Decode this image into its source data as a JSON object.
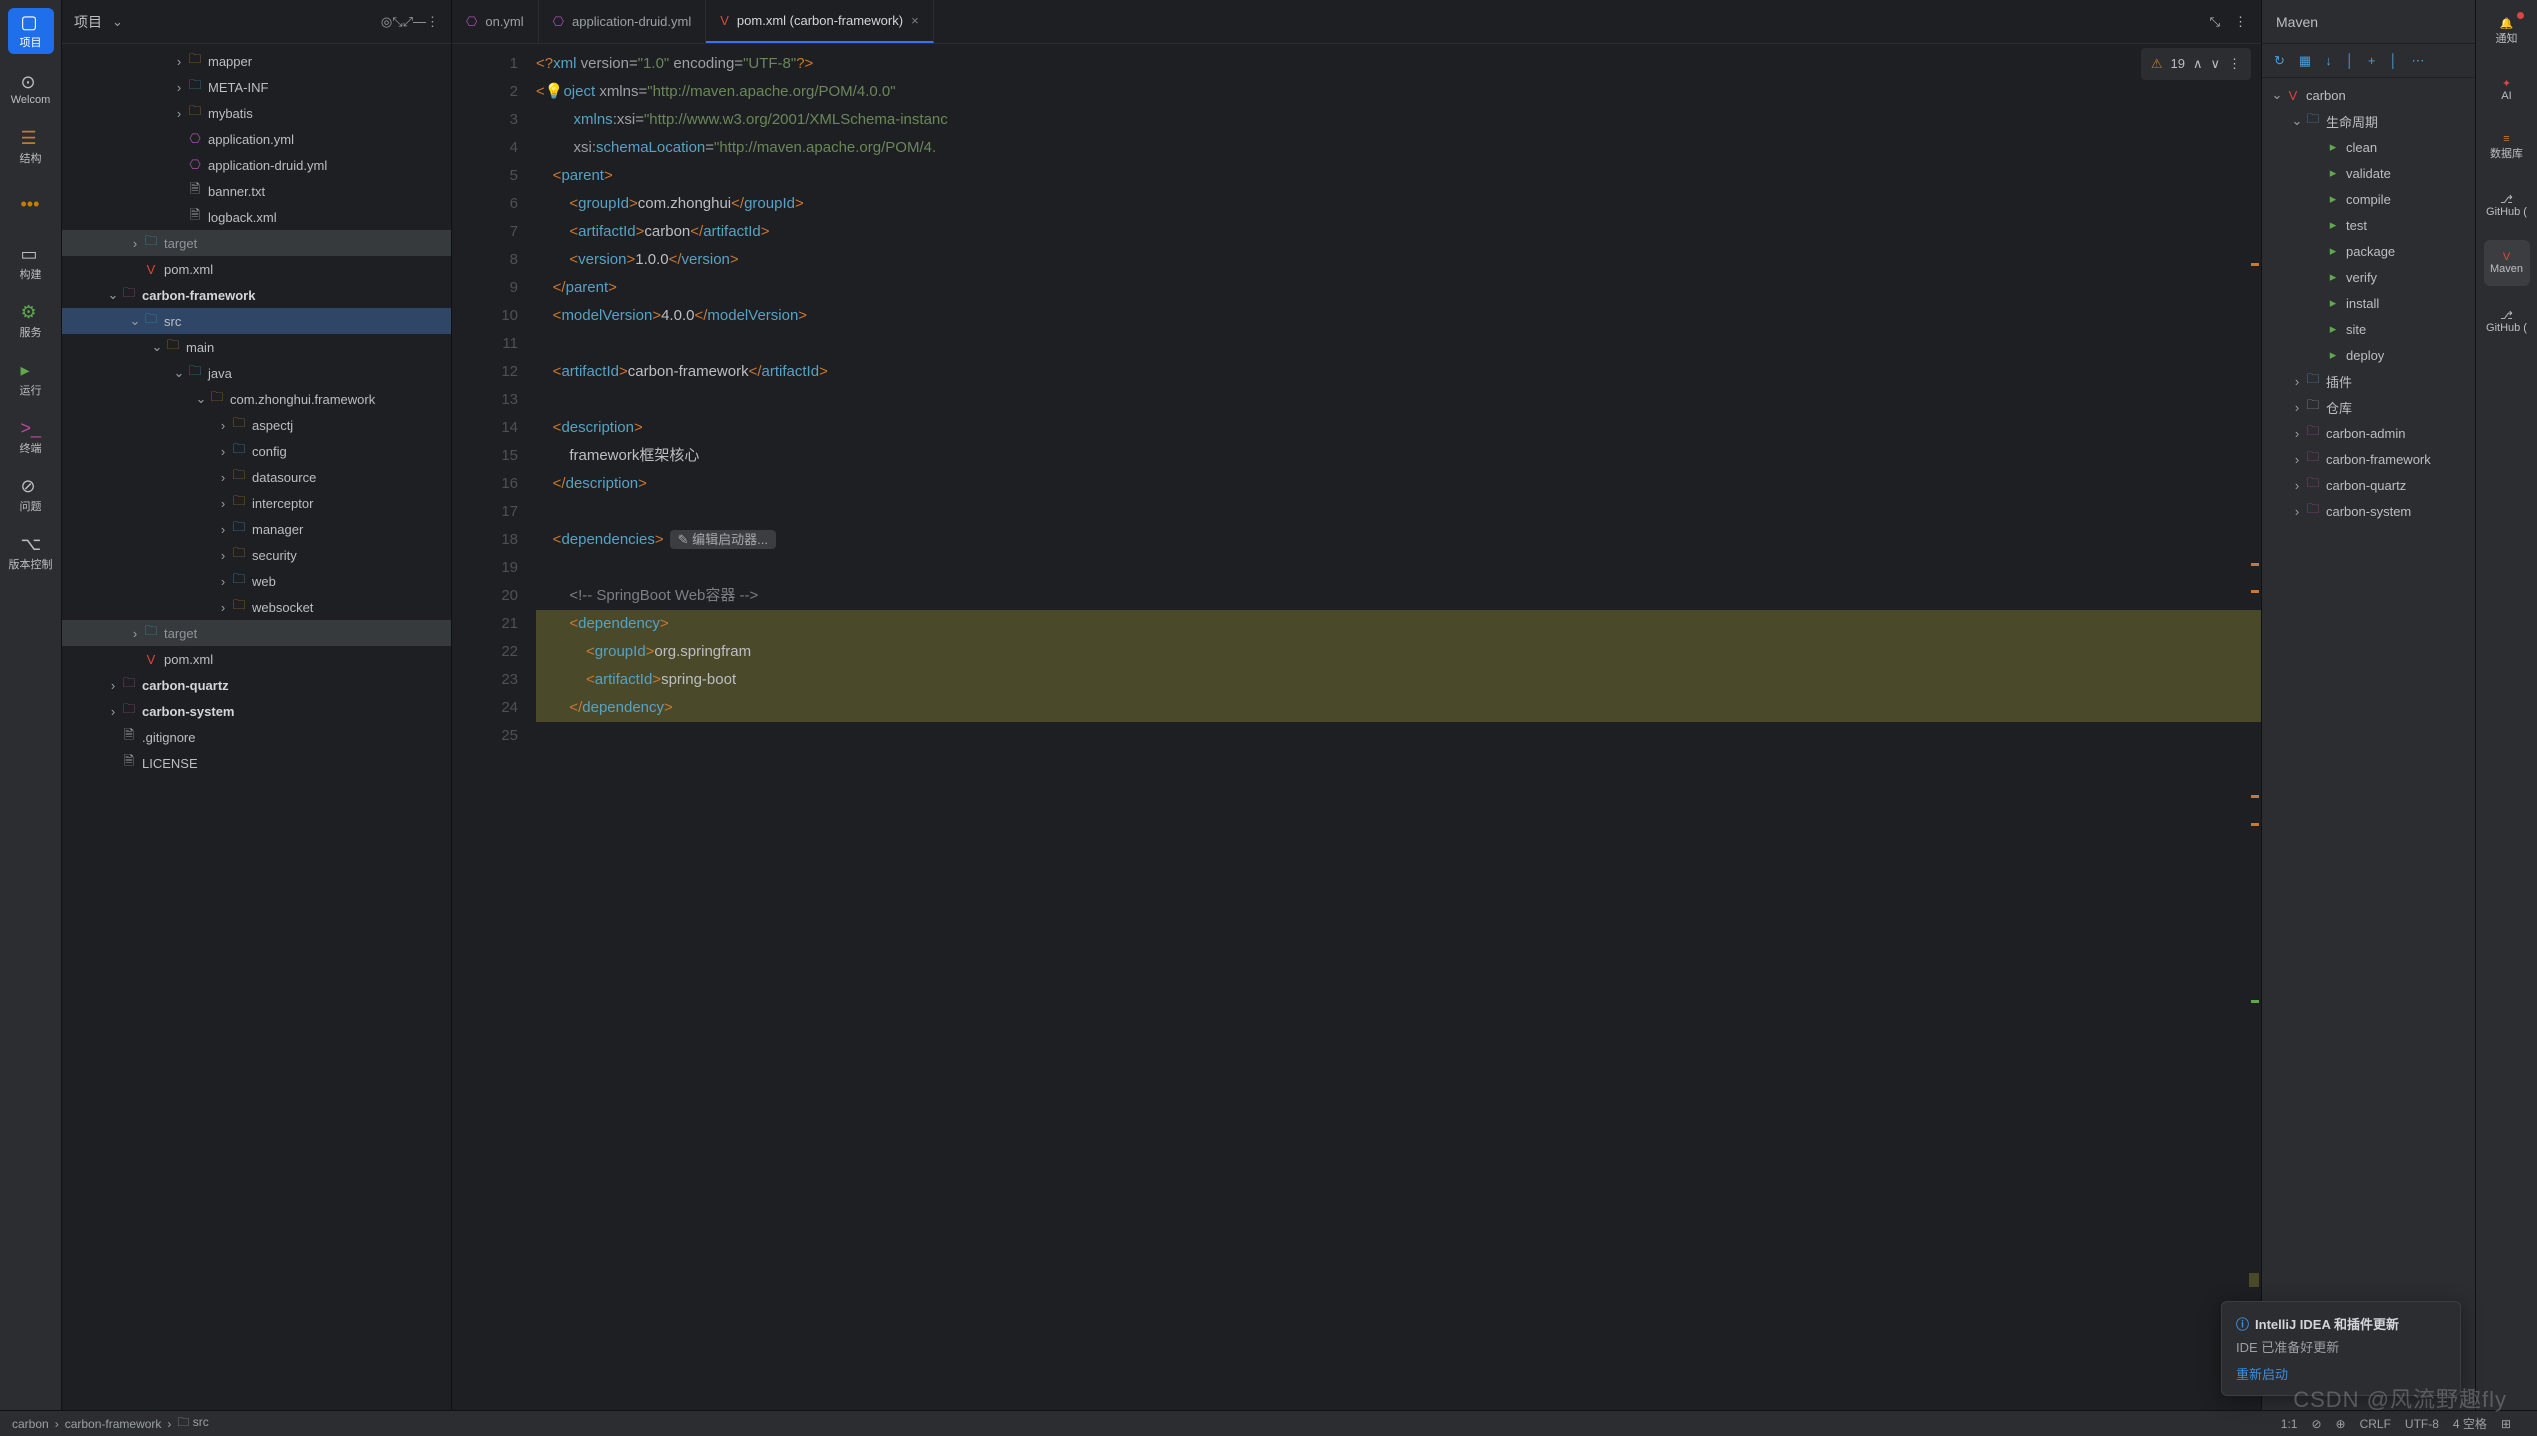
{
  "leftStrip": [
    {
      "icon": "▢",
      "label": "项目",
      "sel": true
    },
    {
      "icon": "⊙",
      "label": "Welcom"
    },
    {
      "icon": "☰",
      "label": "结构",
      "color": "#c07c2e"
    },
    {
      "icon": "•••",
      "label": "",
      "color": "#c77d00"
    },
    {
      "icon": "▭",
      "label": "构建"
    },
    {
      "icon": "⚙",
      "label": "服务",
      "color": "#5fa84c"
    },
    {
      "icon": "▸",
      "label": "运行",
      "color": "#5fa84c"
    },
    {
      "icon": ">_",
      "label": "终端",
      "color": "#b84a9e"
    },
    {
      "icon": "⊘",
      "label": "问题"
    },
    {
      "icon": "⌥",
      "label": "版本控制"
    }
  ],
  "project": {
    "title": "项目",
    "headIcons": [
      "◎",
      "⤡",
      "⤢",
      "—",
      "⋮"
    ],
    "tree": [
      {
        "d": 5,
        "chev": "›",
        "ic": "fold",
        "t": "mapper"
      },
      {
        "d": 5,
        "chev": "›",
        "ic": "folda",
        "t": "META-INF"
      },
      {
        "d": 5,
        "chev": "›",
        "ic": "fold",
        "t": "mybatis"
      },
      {
        "d": 5,
        "chev": "",
        "ic": "yml",
        "t": "application.yml"
      },
      {
        "d": 5,
        "chev": "",
        "ic": "yml",
        "t": "application-druid.yml"
      },
      {
        "d": 5,
        "chev": "",
        "ic": "file",
        "t": "banner.txt"
      },
      {
        "d": 5,
        "chev": "",
        "ic": "file",
        "t": "logback.xml"
      },
      {
        "d": 3,
        "chev": "›",
        "ic": "folda",
        "t": "target",
        "dim": true
      },
      {
        "d": 3,
        "chev": "",
        "ic": "mvn",
        "t": "pom.xml"
      },
      {
        "d": 2,
        "chev": "⌄",
        "ic": "mdl",
        "t": "carbon-framework",
        "bold": true
      },
      {
        "d": 3,
        "chev": "⌄",
        "ic": "folda",
        "t": "src",
        "sel": true
      },
      {
        "d": 4,
        "chev": "⌄",
        "ic": "fold",
        "t": "main"
      },
      {
        "d": 5,
        "chev": "⌄",
        "ic": "pkg",
        "t": "java"
      },
      {
        "d": 6,
        "chev": "⌄",
        "ic": "fold",
        "t": "com.zhonghui.framework"
      },
      {
        "d": 7,
        "chev": "›",
        "ic": "fold",
        "t": "aspectj"
      },
      {
        "d": 7,
        "chev": "›",
        "ic": "cfg",
        "t": "config"
      },
      {
        "d": 7,
        "chev": "›",
        "ic": "fold",
        "t": "datasource"
      },
      {
        "d": 7,
        "chev": "›",
        "ic": "fold",
        "t": "interceptor"
      },
      {
        "d": 7,
        "chev": "›",
        "ic": "cfg",
        "t": "manager"
      },
      {
        "d": 7,
        "chev": "›",
        "ic": "fold",
        "t": "security"
      },
      {
        "d": 7,
        "chev": "›",
        "ic": "cfg",
        "t": "web"
      },
      {
        "d": 7,
        "chev": "›",
        "ic": "fold",
        "t": "websocket"
      },
      {
        "d": 3,
        "chev": "›",
        "ic": "folda",
        "t": "target",
        "dim": true
      },
      {
        "d": 3,
        "chev": "",
        "ic": "mvn",
        "t": "pom.xml"
      },
      {
        "d": 2,
        "chev": "›",
        "ic": "mdl",
        "t": "carbon-quartz",
        "bold": true
      },
      {
        "d": 2,
        "chev": "›",
        "ic": "mdl",
        "t": "carbon-system",
        "bold": true
      },
      {
        "d": 2,
        "chev": "",
        "ic": "file",
        "t": ".gitignore"
      },
      {
        "d": 2,
        "chev": "",
        "ic": "file",
        "t": "LICENSE"
      }
    ]
  },
  "tabs": [
    {
      "icon": "yml",
      "label": "on.yml",
      "trunc": true
    },
    {
      "icon": "yml",
      "label": "application-druid.yml"
    },
    {
      "icon": "mvn",
      "label": "pom.xml (carbon-framework)",
      "active": true,
      "close": true
    }
  ],
  "tabActions": [
    "⤡",
    "⋮"
  ],
  "inspection": {
    "warnIcon": "⚠",
    "count": "19",
    "up": "∧",
    "down": "∨"
  },
  "code": {
    "lines": [
      {
        "n": 1,
        "seg": [
          [
            "dec",
            "<?"
          ],
          [
            "tag",
            "xml "
          ],
          [
            "attr",
            "version="
          ],
          [
            "str",
            "\"1.0\" "
          ],
          [
            "attr",
            "encoding="
          ],
          [
            "str",
            "\"UTF-8\""
          ],
          [
            "dec",
            "?>"
          ]
        ]
      },
      {
        "n": 2,
        "bulb": true,
        "seg": [
          [
            "dec",
            "<"
          ],
          [
            "bulb",
            "💡"
          ],
          [
            "tag",
            "oject "
          ],
          [
            "attr",
            "xmlns="
          ],
          [
            "str",
            "\"http://maven.apache.org/POM/4.0.0\""
          ]
        ]
      },
      {
        "n": 3,
        "seg": [
          [
            "txt",
            "         "
          ],
          [
            "tag",
            "xmlns"
          ],
          [
            "attr",
            ":xsi="
          ],
          [
            "str",
            "\"http://www.w3.org/2001/XMLSchema-instanc"
          ]
        ]
      },
      {
        "n": 4,
        "seg": [
          [
            "txt",
            "         "
          ],
          [
            "attr",
            "xsi:"
          ],
          [
            "tag",
            "schemaLocation"
          ],
          [
            "attr",
            "="
          ],
          [
            "str",
            "\"http://maven.apache.org/POM/4."
          ]
        ]
      },
      {
        "n": 5,
        "gic": "✓",
        "seg": [
          [
            "txt",
            "    "
          ],
          [
            "dec",
            "<"
          ],
          [
            "tag",
            "parent"
          ],
          [
            "dec",
            ">"
          ]
        ]
      },
      {
        "n": 6,
        "seg": [
          [
            "txt",
            "        "
          ],
          [
            "dec",
            "<"
          ],
          [
            "tag",
            "groupId"
          ],
          [
            "dec",
            ">"
          ],
          [
            "txt",
            "com.zhonghui"
          ],
          [
            "dec",
            "</"
          ],
          [
            "tag",
            "groupId"
          ],
          [
            "dec",
            ">"
          ]
        ]
      },
      {
        "n": 7,
        "seg": [
          [
            "txt",
            "        "
          ],
          [
            "dec",
            "<"
          ],
          [
            "tag",
            "artifactId"
          ],
          [
            "dec",
            ">"
          ],
          [
            "txt",
            "carbon"
          ],
          [
            "dec",
            "</"
          ],
          [
            "tag",
            "artifactId"
          ],
          [
            "dec",
            ">"
          ]
        ]
      },
      {
        "n": 8,
        "seg": [
          [
            "txt",
            "        "
          ],
          [
            "dec",
            "<"
          ],
          [
            "tag",
            "version"
          ],
          [
            "dec",
            ">"
          ],
          [
            "txt",
            "1.0.0"
          ],
          [
            "dec",
            "</"
          ],
          [
            "tag",
            "version"
          ],
          [
            "dec",
            ">"
          ]
        ]
      },
      {
        "n": 9,
        "seg": [
          [
            "txt",
            "    "
          ],
          [
            "dec",
            "</"
          ],
          [
            "tag",
            "parent"
          ],
          [
            "dec",
            ">"
          ]
        ]
      },
      {
        "n": 10,
        "seg": [
          [
            "txt",
            "    "
          ],
          [
            "dec",
            "<"
          ],
          [
            "tag",
            "modelVersion"
          ],
          [
            "dec",
            ">"
          ],
          [
            "txt",
            "4.0.0"
          ],
          [
            "dec",
            "</"
          ],
          [
            "tag",
            "modelVersion"
          ],
          [
            "dec",
            ">"
          ]
        ]
      },
      {
        "n": 11,
        "seg": []
      },
      {
        "n": 12,
        "seg": [
          [
            "txt",
            "    "
          ],
          [
            "dec",
            "<"
          ],
          [
            "tag",
            "artifactId"
          ],
          [
            "dec",
            ">"
          ],
          [
            "txt",
            "carbon-framework"
          ],
          [
            "dec",
            "</"
          ],
          [
            "tag",
            "artifactId"
          ],
          [
            "dec",
            ">"
          ]
        ]
      },
      {
        "n": 13,
        "seg": []
      },
      {
        "n": 14,
        "seg": [
          [
            "txt",
            "    "
          ],
          [
            "dec",
            "<"
          ],
          [
            "tag",
            "description"
          ],
          [
            "dec",
            ">"
          ]
        ]
      },
      {
        "n": 15,
        "seg": [
          [
            "txt",
            "        framework框架核心"
          ]
        ]
      },
      {
        "n": 16,
        "seg": [
          [
            "txt",
            "    "
          ],
          [
            "dec",
            "</"
          ],
          [
            "tag",
            "description"
          ],
          [
            "dec",
            ">"
          ]
        ]
      },
      {
        "n": 17,
        "seg": []
      },
      {
        "n": 18,
        "inlay": "编辑启动器...",
        "inlayIcon": "✎",
        "seg": [
          [
            "txt",
            "    "
          ],
          [
            "dec",
            "<"
          ],
          [
            "tag",
            "dependencies"
          ],
          [
            "dec",
            ">"
          ]
        ]
      },
      {
        "n": 19,
        "seg": []
      },
      {
        "n": 20,
        "seg": [
          [
            "txt",
            "        "
          ],
          [
            "cmt",
            "<!-- SpringBoot Web容器 -->"
          ]
        ]
      },
      {
        "n": 21,
        "gic": "⇥",
        "hl": true,
        "seg": [
          [
            "txt",
            "        "
          ],
          [
            "dec",
            "<"
          ],
          [
            "tag",
            "dependency"
          ],
          [
            "dec",
            ">"
          ]
        ]
      },
      {
        "n": 22,
        "hl": true,
        "seg": [
          [
            "txt",
            "            "
          ],
          [
            "dec",
            "<"
          ],
          [
            "tag",
            "groupId"
          ],
          [
            "dec",
            ">"
          ],
          [
            "txt",
            "org.springfram"
          ]
        ]
      },
      {
        "n": 23,
        "hl": true,
        "seg": [
          [
            "txt",
            "            "
          ],
          [
            "dec",
            "<"
          ],
          [
            "tag",
            "artifactId"
          ],
          [
            "dec",
            ">"
          ],
          [
            "txt",
            "spring-boot"
          ]
        ]
      },
      {
        "n": 24,
        "hl": true,
        "seg": [
          [
            "txt",
            "        "
          ],
          [
            "dec",
            "</"
          ],
          [
            "tag",
            "dependency"
          ],
          [
            "dec",
            ">"
          ]
        ]
      },
      {
        "n": 25,
        "seg": []
      }
    ]
  },
  "maven": {
    "title": "Maven",
    "toolbar": [
      "↻",
      "▦",
      "↓",
      "│",
      "+",
      "│",
      "⋯"
    ],
    "tree": [
      {
        "d": 0,
        "chev": "⌄",
        "ic": "mvn",
        "t": "carbon"
      },
      {
        "d": 1,
        "chev": "⌄",
        "ic": "fold",
        "t": "生命周期"
      },
      {
        "d": 2,
        "ic": "run",
        "t": "clean"
      },
      {
        "d": 2,
        "ic": "run",
        "t": "validate"
      },
      {
        "d": 2,
        "ic": "run",
        "t": "compile"
      },
      {
        "d": 2,
        "ic": "run",
        "t": "test"
      },
      {
        "d": 2,
        "ic": "run",
        "t": "package"
      },
      {
        "d": 2,
        "ic": "run",
        "t": "verify"
      },
      {
        "d": 2,
        "ic": "run",
        "t": "install"
      },
      {
        "d": 2,
        "ic": "run",
        "t": "site"
      },
      {
        "d": 2,
        "ic": "run",
        "t": "deploy"
      },
      {
        "d": 1,
        "chev": "›",
        "ic": "fold",
        "t": "插件"
      },
      {
        "d": 1,
        "chev": "›",
        "ic": "fold",
        "t": "仓库",
        "grey": true
      },
      {
        "d": 1,
        "chev": "›",
        "ic": "mod",
        "t": "carbon-admin"
      },
      {
        "d": 1,
        "chev": "›",
        "ic": "mod",
        "t": "carbon-framework"
      },
      {
        "d": 1,
        "chev": "›",
        "ic": "mod",
        "t": "carbon-quartz"
      },
      {
        "d": 1,
        "chev": "›",
        "ic": "mod",
        "t": "carbon-system"
      }
    ]
  },
  "rightStrip": [
    {
      "icon": "🔔",
      "label": "通知",
      "dot": true
    },
    {
      "icon": "✦",
      "label": "AI",
      "color": "#d44"
    },
    {
      "icon": "≡",
      "label": "数据库",
      "color": "#c07c2e"
    },
    {
      "icon": "⎇",
      "label": "GitHub ("
    },
    {
      "icon": "V",
      "label": "Maven",
      "color": "#e2443b",
      "sel": true
    },
    {
      "icon": "⎇",
      "label": "GitHub ("
    }
  ],
  "breadcrumb": [
    "carbon",
    "carbon-framework",
    "src"
  ],
  "status": {
    "pos": "1:1",
    "items": [
      "⊘",
      "⊕",
      "CRLF",
      "UTF-8",
      "4 空格",
      "⊞"
    ]
  },
  "notif": {
    "icon": "ⓘ",
    "title": "IntelliJ IDEA 和插件更新",
    "body": "IDE 已准备好更新",
    "action": "重新启动"
  },
  "watermark": "CSDN @风流野趣fly"
}
